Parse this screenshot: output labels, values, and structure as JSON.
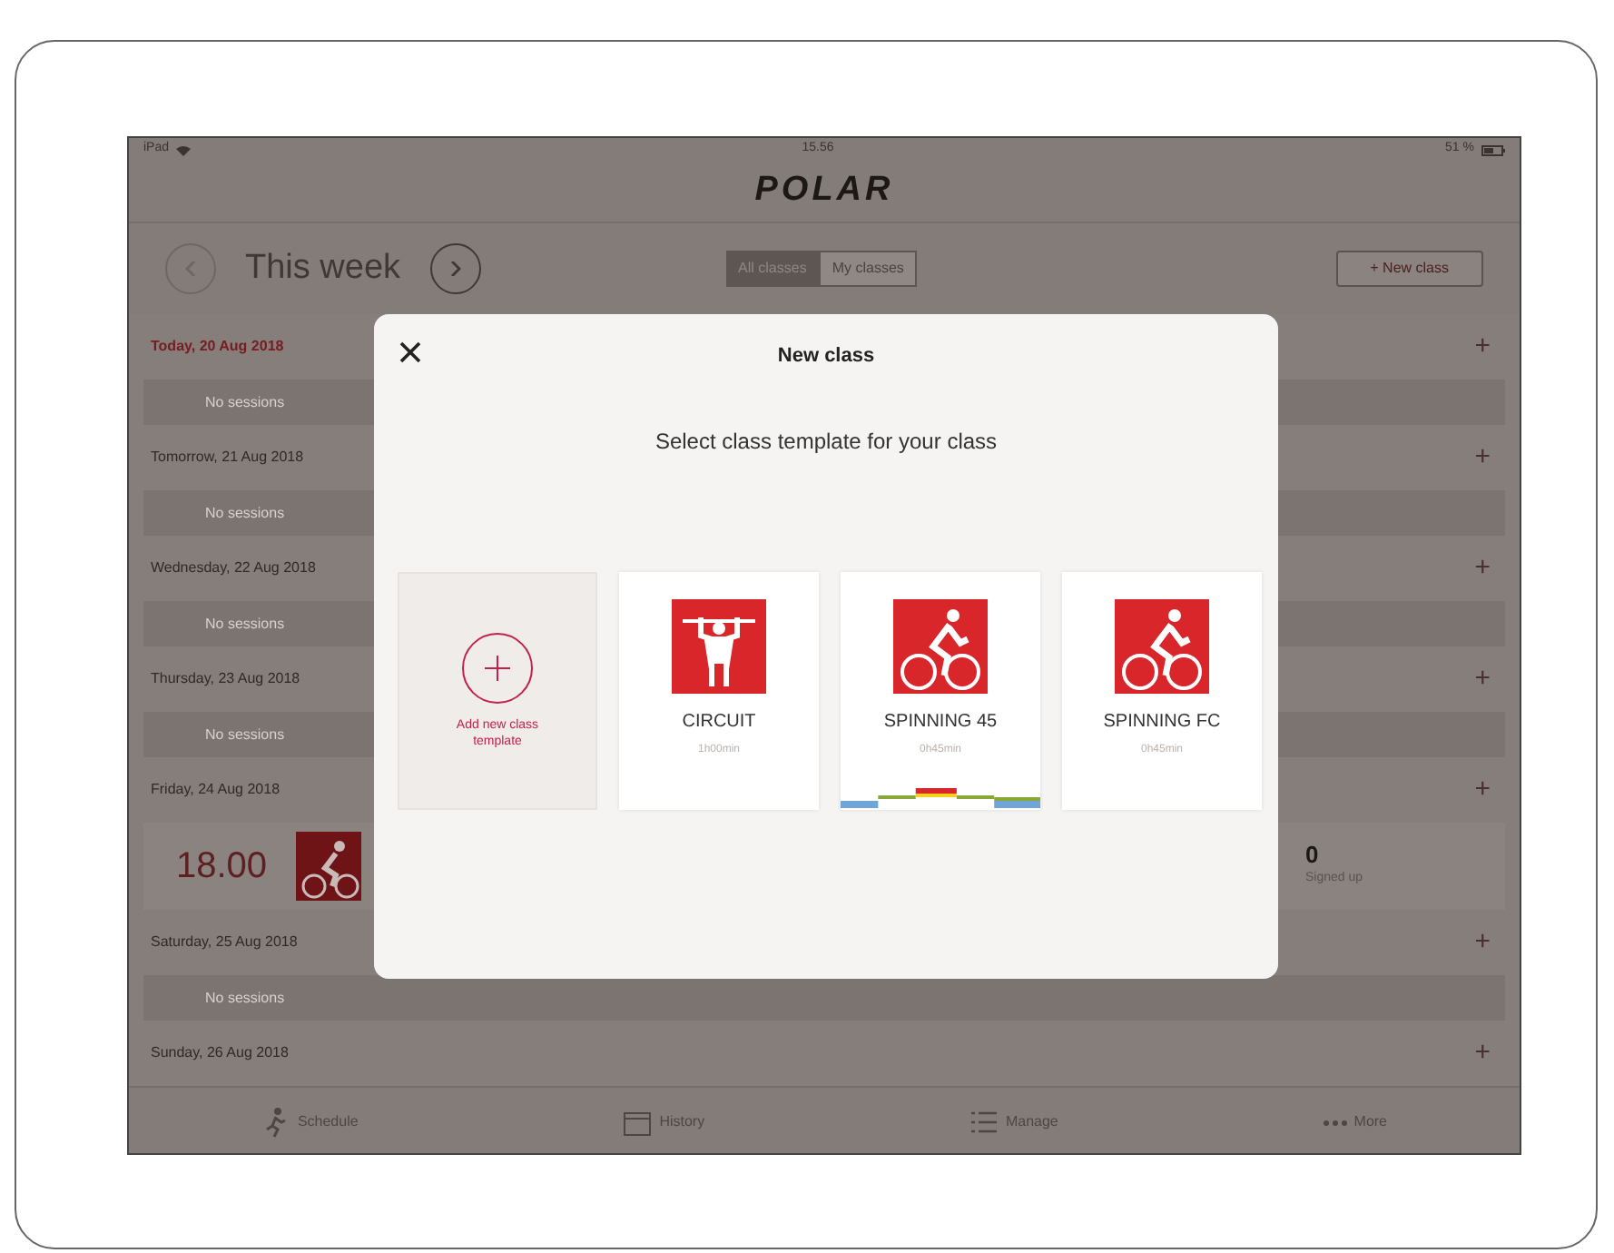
{
  "status_bar": {
    "device": "iPad",
    "time": "15.56",
    "battery": "51 %"
  },
  "header": {
    "logo": "POLAR"
  },
  "week_nav": {
    "title": "This week"
  },
  "filter": [
    {
      "label": "All classes",
      "selected": true
    },
    {
      "label": "My classes",
      "selected": false
    }
  ],
  "new_class_button": "+ New class",
  "days": [
    {
      "label": "Today, 20 Aug 2018",
      "today": true,
      "add": "+",
      "slot": {
        "kind": "empty",
        "text": "No sessions"
      }
    },
    {
      "label": "Tomorrow, 21 Aug 2018",
      "today": false,
      "add": "+",
      "slot": {
        "kind": "empty",
        "text": "No sessions"
      }
    },
    {
      "label": "Wednesday, 22 Aug 2018",
      "today": false,
      "add": "+",
      "slot": {
        "kind": "empty",
        "text": "No sessions"
      }
    },
    {
      "label": "Thursday, 23 Aug 2018",
      "today": false,
      "add": "+",
      "slot": {
        "kind": "empty",
        "text": "No sessions"
      }
    },
    {
      "label": "Friday, 24 Aug 2018",
      "today": false,
      "add": "+",
      "slot": {
        "kind": "session",
        "time": "18.00",
        "count": "0",
        "count_label": "Signed up"
      }
    },
    {
      "label": "Saturday, 25 Aug 2018",
      "today": false,
      "add": "+",
      "slot": {
        "kind": "empty",
        "text": "No sessions"
      }
    },
    {
      "label": "Sunday, 26 Aug 2018",
      "today": false,
      "add": "+"
    }
  ],
  "modal": {
    "title": "New class",
    "subtitle": "Select class template for your class",
    "add_card": {
      "label": "Add new class template"
    },
    "templates": [
      {
        "name": "CIRCUIT",
        "duration": "1h00min",
        "kind": "circuit",
        "profile": false
      },
      {
        "name": "SPINNING 45",
        "duration": "0h45min",
        "kind": "bike",
        "profile": true
      },
      {
        "name": "SPINNING FC",
        "duration": "0h45min",
        "kind": "bike",
        "profile": false
      }
    ]
  },
  "tab_bar": [
    {
      "label": "Schedule",
      "kind": "run"
    },
    {
      "label": "History",
      "kind": "calendar"
    },
    {
      "label": "Manage",
      "kind": "list"
    },
    {
      "label": "More",
      "kind": "dots"
    }
  ]
}
